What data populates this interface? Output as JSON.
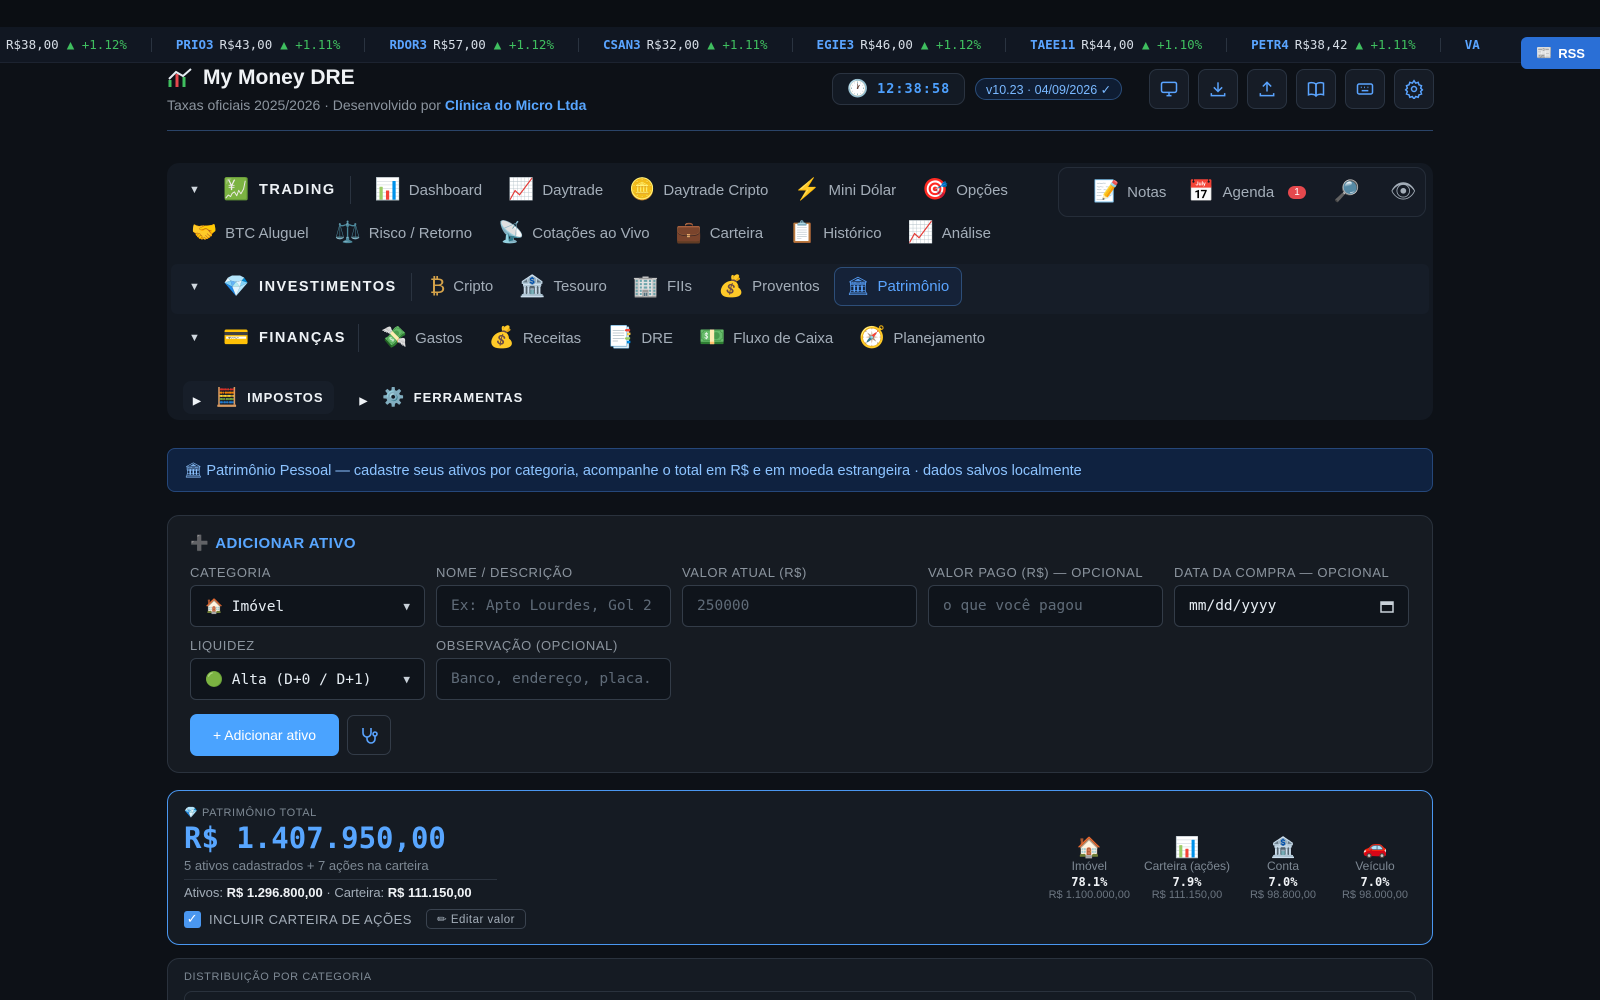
{
  "ticker": [
    {
      "sym": "",
      "price": "R$38,00",
      "chg": "▲ +1.12%"
    },
    {
      "sym": "PRIO3",
      "price": "R$43,00",
      "chg": "▲ +1.11%"
    },
    {
      "sym": "RDOR3",
      "price": "R$57,00",
      "chg": "▲ +1.12%"
    },
    {
      "sym": "CSAN3",
      "price": "R$32,00",
      "chg": "▲ +1.11%"
    },
    {
      "sym": "EGIE3",
      "price": "R$46,00",
      "chg": "▲ +1.12%"
    },
    {
      "sym": "TAEE11",
      "price": "R$44,00",
      "chg": "▲ +1.10%"
    },
    {
      "sym": "PETR4",
      "price": "R$38,42",
      "chg": "▲ +1.11%"
    },
    {
      "sym": "VA",
      "price": "",
      "chg": ""
    }
  ],
  "rss_label": "RSS",
  "header": {
    "title": "My Money DRE",
    "subtitle_prefix": "Taxas oficiais 2025/2026 · Desenvolvido por ",
    "subtitle_link": "Clínica do Micro Ltda",
    "clock": "12:38:58",
    "version": "v10.23 · 04/09/2026 ✓",
    "buttons": [
      "monitor-icon",
      "download-icon",
      "upload-icon",
      "book-icon",
      "keyboard-icon",
      "gear-icon"
    ]
  },
  "nav": {
    "trading": {
      "label": "TRADING",
      "items": [
        {
          "icon": "📊",
          "label": "Dashboard"
        },
        {
          "icon": "📈",
          "label": "Daytrade"
        },
        {
          "icon": "🪙",
          "label": "Daytrade Cripto"
        },
        {
          "icon": "⚡",
          "label": "Mini Dólar"
        },
        {
          "icon": "🎯",
          "label": "Opções"
        }
      ],
      "items_row2": [
        {
          "icon": "🤝",
          "label": "BTC Aluguel"
        },
        {
          "icon": "⚖️",
          "label": "Risco / Retorno"
        },
        {
          "icon": "📡",
          "label": "Cotações ao Vivo"
        },
        {
          "icon": "💼",
          "label": "Carteira"
        },
        {
          "icon": "📋",
          "label": "Histórico"
        },
        {
          "icon": "📈",
          "label": "Análise"
        }
      ]
    },
    "investimentos": {
      "label": "INVESTIMENTOS",
      "items": [
        {
          "icon": "₿",
          "label": "Cripto"
        },
        {
          "icon": "🏦",
          "label": "Tesouro"
        },
        {
          "icon": "🏢",
          "label": "FIIs"
        },
        {
          "icon": "💰",
          "label": "Proventos"
        },
        {
          "icon": "🏛",
          "label": "Patrimônio"
        }
      ]
    },
    "financas": {
      "label": "FINANÇAS",
      "items": [
        {
          "icon": "💸",
          "label": "Gastos"
        },
        {
          "icon": "💰",
          "label": "Receitas"
        },
        {
          "icon": "📑",
          "label": "DRE"
        },
        {
          "icon": "💵",
          "label": "Fluxo de Caixa"
        },
        {
          "icon": "🧭",
          "label": "Planejamento"
        }
      ]
    },
    "impostos": {
      "label": "IMPOSTOS"
    },
    "ferramentas": {
      "label": "FERRAMENTAS"
    },
    "quick": {
      "notas": "Notas",
      "agenda": "Agenda",
      "agenda_badge": "1"
    }
  },
  "banner": "🏛 Patrimônio Pessoal — cadastre seus ativos por categoria, acompanhe o total em R$ e em moeda estrangeira · dados salvos localmente",
  "form": {
    "title": "ADICIONAR ATIVO",
    "categoria_label": "CATEGORIA",
    "categoria_value": "🏠 Imóvel",
    "nome_label": "NOME / DESCRIÇÃO",
    "nome_placeholder": "Ex: Apto Lourdes, Gol 2",
    "valor_label": "VALOR ATUAL (R$)",
    "valor_placeholder": "250000",
    "pago_label": "VALOR PAGO (R$) — OPCIONAL",
    "pago_placeholder": "o que você pagou",
    "data_label": "DATA DA COMPRA — OPCIONAL",
    "data_placeholder": "mm/dd/yyyy",
    "liquidez_label": "LIQUIDEZ",
    "liquidez_value": "🟢 Alta (D+0 / D+1)",
    "obs_label": "OBSERVAÇÃO (OPCIONAL)",
    "obs_placeholder": "Banco, endereço, placa.",
    "add_button": "+ Adicionar ativo"
  },
  "total": {
    "label": "💎 PATRIMÔNIO TOTAL",
    "value": "R$ 1.407.950,00",
    "sub": "5 ativos cadastrados + 7 ações na carteira",
    "ativos_label": "Ativos: ",
    "ativos_value": "R$ 1.296.800,00",
    "carteira_label": " · Carteira: ",
    "carteira_value": "R$ 111.150,00",
    "include_label": "INCLUIR CARTEIRA DE AÇÕES",
    "edit_button": "✏ Editar valor",
    "categories": [
      {
        "icon": "🏠",
        "name": "Imóvel",
        "pct": "78.1%",
        "value": "R$ 1.100.000,00"
      },
      {
        "icon": "📊",
        "name": "Carteira (ações)",
        "pct": "7.9%",
        "value": "R$ 111.150,00"
      },
      {
        "icon": "🏦",
        "name": "Conta",
        "pct": "7.0%",
        "value": "R$ 98.800,00"
      },
      {
        "icon": "🚗",
        "name": "Veículo",
        "pct": "7.0%",
        "value": "R$ 98.000,00"
      }
    ]
  },
  "distribution_label": "DISTRIBUIÇÃO POR CATEGORIA"
}
